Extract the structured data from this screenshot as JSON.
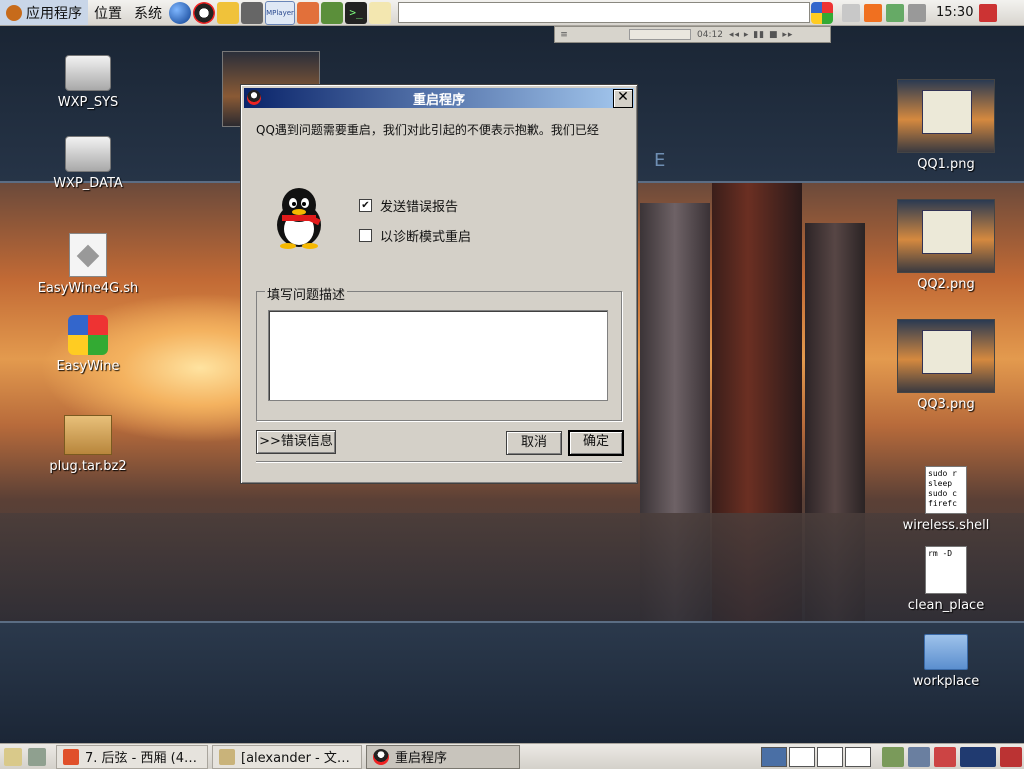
{
  "top_panel": {
    "menus": [
      "应用程序",
      "位置",
      "系统"
    ],
    "launchers": {
      "mplayer": "MPlayer",
      "terminal": ">_"
    },
    "clock": "15:30"
  },
  "media_bar": {
    "time": "04:12",
    "controls": "◂◂ ▸ ▮▮ ■ ▸▸"
  },
  "desktop_icons": {
    "wxp_sys": "WXP_SYS",
    "wxp_data": "WXP_DATA",
    "easywine_sh": "EasyWine4G.sh",
    "easywine": "EasyWine",
    "plug": "plug.tar.bz2",
    "qq1": "QQ1.png",
    "qq2": "QQ2.png",
    "qq3": "QQ3.png",
    "wireless": "wireless.shell",
    "clean": "clean_place",
    "workplace": "workplace"
  },
  "scripts": {
    "wireless_preview": "sudo r\nsleep\nsudo c\nfirefc",
    "clean_preview": "rm -D"
  },
  "wallpaper": {
    "letter": "E"
  },
  "dialog": {
    "title": "重启程序",
    "message": "QQ遇到问题需要重启，我们对此引起的不便表示抱歉。我们已经",
    "checkbox_send_report": {
      "label": "发送错误报告",
      "checked": true
    },
    "checkbox_diagnostic": {
      "label": "以诊断模式重启",
      "checked": false
    },
    "group_label": "填写问题描述",
    "textarea_value": "",
    "details_button": ">>错误信息",
    "cancel_button": "取消",
    "ok_button": "确定",
    "check_mark": "✔",
    "close_symbol": "✕"
  },
  "taskbar": {
    "tasks": [
      {
        "label": "7. 后弦 - 西厢 (4…",
        "active": false
      },
      {
        "label": "[alexander - 文…",
        "active": false
      },
      {
        "label": "重启程序",
        "active": true
      }
    ]
  },
  "colors": {
    "titlebar_start": "#0a246a",
    "titlebar_end": "#a6caf0",
    "dialog_face": "#d4d0c8"
  }
}
